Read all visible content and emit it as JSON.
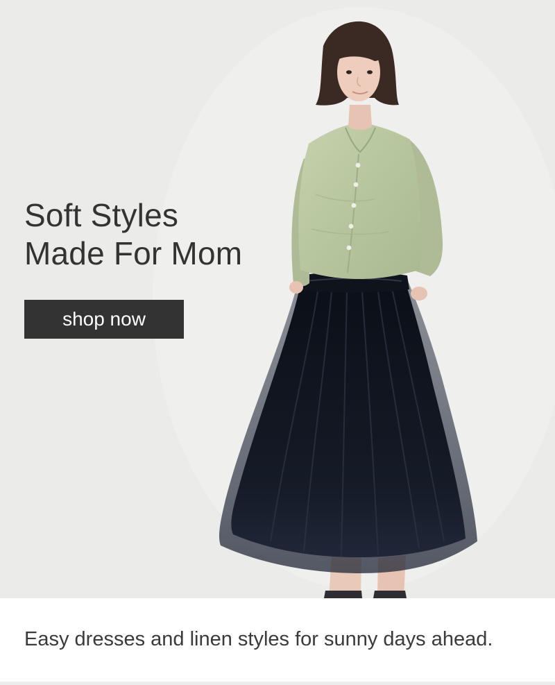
{
  "hero": {
    "headline_line1": "Soft Styles",
    "headline_line2": "Made For Mom",
    "cta_label": "shop now",
    "background_color": "#e9e9e8"
  },
  "caption": {
    "text": "Easy dresses and linen styles for sunny days ahead."
  },
  "colors": {
    "headline": "#333333",
    "button_background": "#333333",
    "button_text": "#ffffff",
    "shirt": "#b9c79f",
    "skirt": "#111621"
  }
}
